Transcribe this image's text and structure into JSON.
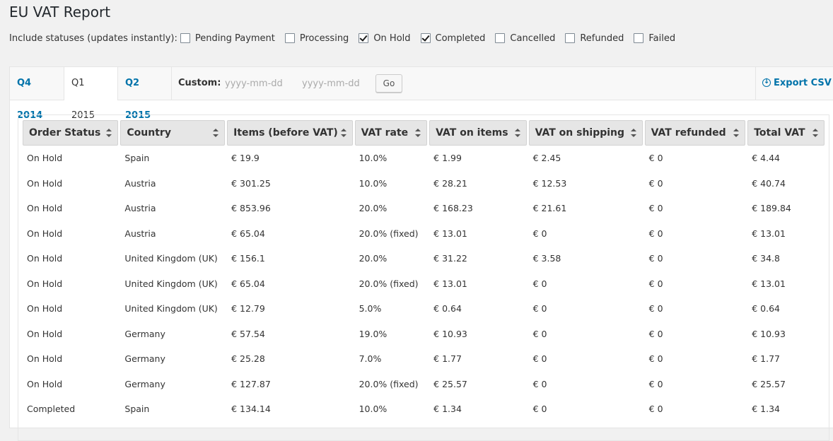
{
  "page": {
    "title": "EU VAT Report"
  },
  "statuses": {
    "intro": "Include statuses (updates instantly):",
    "items": [
      {
        "label": "Pending Payment",
        "checked": false
      },
      {
        "label": "Processing",
        "checked": false
      },
      {
        "label": "On Hold",
        "checked": true
      },
      {
        "label": "Completed",
        "checked": true
      },
      {
        "label": "Cancelled",
        "checked": false
      },
      {
        "label": "Refunded",
        "checked": false
      },
      {
        "label": "Failed",
        "checked": false
      }
    ]
  },
  "tabs": [
    {
      "label": "Q4 2014",
      "active": false
    },
    {
      "label": "Q1 2015",
      "active": true
    },
    {
      "label": "Q2 2015",
      "active": false
    }
  ],
  "custom": {
    "label": "Custom:",
    "start_placeholder": "yyyy-mm-dd",
    "end_placeholder": "yyyy-mm-dd",
    "go_label": "Go"
  },
  "export_label": "Export CSV",
  "table": {
    "columns": [
      "Order Status",
      "Country",
      "Items (before VAT)",
      "VAT rate",
      "VAT on items",
      "VAT on shipping",
      "VAT refunded",
      "Total VAT"
    ],
    "rows": [
      [
        "On Hold",
        "Spain",
        "€ 19.9",
        "10.0%",
        "€ 1.99",
        "€ 2.45",
        "€ 0",
        "€ 4.44"
      ],
      [
        "On Hold",
        "Austria",
        "€ 301.25",
        "10.0%",
        "€ 28.21",
        "€ 12.53",
        "€ 0",
        "€ 40.74"
      ],
      [
        "On Hold",
        "Austria",
        "€ 853.96",
        "20.0%",
        "€ 168.23",
        "€ 21.61",
        "€ 0",
        "€ 189.84"
      ],
      [
        "On Hold",
        "Austria",
        "€ 65.04",
        "20.0% (fixed)",
        "€ 13.01",
        "€ 0",
        "€ 0",
        "€ 13.01"
      ],
      [
        "On Hold",
        "United Kingdom (UK)",
        "€ 156.1",
        "20.0%",
        "€ 31.22",
        "€ 3.58",
        "€ 0",
        "€ 34.8"
      ],
      [
        "On Hold",
        "United Kingdom (UK)",
        "€ 65.04",
        "20.0% (fixed)",
        "€ 13.01",
        "€ 0",
        "€ 0",
        "€ 13.01"
      ],
      [
        "On Hold",
        "United Kingdom (UK)",
        "€ 12.79",
        "5.0%",
        "€ 0.64",
        "€ 0",
        "€ 0",
        "€ 0.64"
      ],
      [
        "On Hold",
        "Germany",
        "€ 57.54",
        "19.0%",
        "€ 10.93",
        "€ 0",
        "€ 0",
        "€ 10.93"
      ],
      [
        "On Hold",
        "Germany",
        "€ 25.28",
        "7.0%",
        "€ 1.77",
        "€ 0",
        "€ 0",
        "€ 1.77"
      ],
      [
        "On Hold",
        "Germany",
        "€ 127.87",
        "20.0% (fixed)",
        "€ 25.57",
        "€ 0",
        "€ 0",
        "€ 25.57"
      ],
      [
        "Completed",
        "Spain",
        "€ 134.14",
        "10.0%",
        "€ 1.34",
        "€ 0",
        "€ 0",
        "€ 1.34"
      ]
    ]
  }
}
